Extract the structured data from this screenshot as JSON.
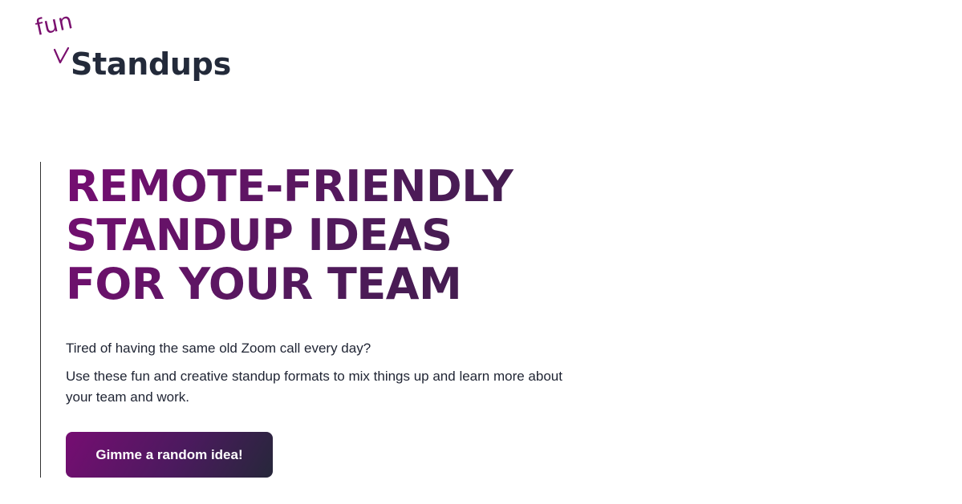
{
  "logo": {
    "accent": "fun",
    "wordmark": "Standups",
    "accent_color": "#7a0f6e",
    "wordmark_color": "#232a3a"
  },
  "hero": {
    "headline_lines": [
      "REMOTE-FRIENDLY",
      "STANDUP IDEAS",
      "FOR YOUR TEAM"
    ],
    "tagline": "Tired of having the same old Zoom call every day?",
    "description": "Use these fun and creative standup formats to mix things up and learn more about your team and work.",
    "cta_label": "Gimme a random idea!",
    "brand_color": "#760d72"
  }
}
